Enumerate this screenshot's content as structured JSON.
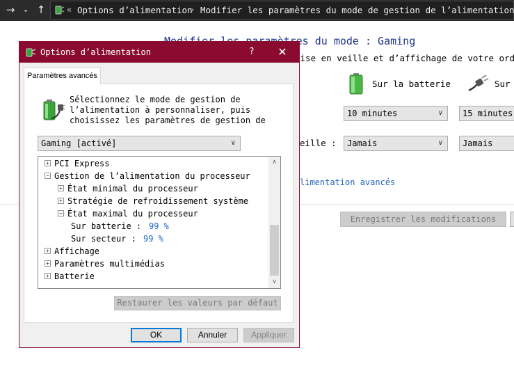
{
  "explorer": {
    "back_icon": "arrow-right",
    "history_icon": "chevron-down",
    "up_icon": "arrow-up",
    "breadcrumb_overflow": "«",
    "breadcrumb": [
      "Options d’alimentation",
      "Modifier les paramètres du mode de gestion de l’alimentation"
    ],
    "breadcrumb_separator": "›"
  },
  "background_page": {
    "title": "Modifier les paramètres du mode : Gaming",
    "subtitle": "mise en veille et d’affichage de votre ordi",
    "battery_label": "Sur la batterie",
    "plugged_label": "Sur",
    "display_off_battery": "10 minutes",
    "display_off_plugged": "15 minutes",
    "sleep_label": "eille :",
    "sleep_battery": "Jamais",
    "sleep_plugged": "Jamais",
    "advanced_link": "limentation avancés",
    "save_button": "Enregistrer les modifications"
  },
  "dialog": {
    "title": "Options d’alimentation",
    "help": "?",
    "close": "✕",
    "tab": "Paramètres avancés",
    "description": [
      "Sélectionnez le mode de gestion de",
      "l’alimentation à personnaliser, puis",
      "choisissez les paramètres de gestion de"
    ],
    "plan_selected": "Gaming [activé]",
    "tree": [
      {
        "label": "PCI Express",
        "exp": "+"
      },
      {
        "label": "Gestion de l’alimentation du processeur",
        "exp": "−"
      },
      {
        "label": "État minimal du processeur",
        "exp": "+"
      },
      {
        "label": "Stratégie de refroidissement système",
        "exp": "+"
      },
      {
        "label": "État maximal du processeur",
        "exp": "−"
      },
      {
        "label": "Sur batterie :",
        "value": "99 %"
      },
      {
        "label": "Sur secteur :",
        "value": "99 %"
      },
      {
        "label": "Affichage",
        "exp": "+"
      },
      {
        "label": "Paramètres multimédias",
        "exp": "+"
      },
      {
        "label": "Batterie",
        "exp": "+"
      }
    ],
    "restore_button": "Restaurer les valeurs par défaut",
    "ok_button": "OK",
    "cancel_button": "Annuler",
    "apply_button": "Appliquer"
  },
  "colors": {
    "titlebar": "#8a0b2f",
    "link": "#1f5fb5",
    "value": "#1a66c4",
    "heading": "#1e3287"
  }
}
